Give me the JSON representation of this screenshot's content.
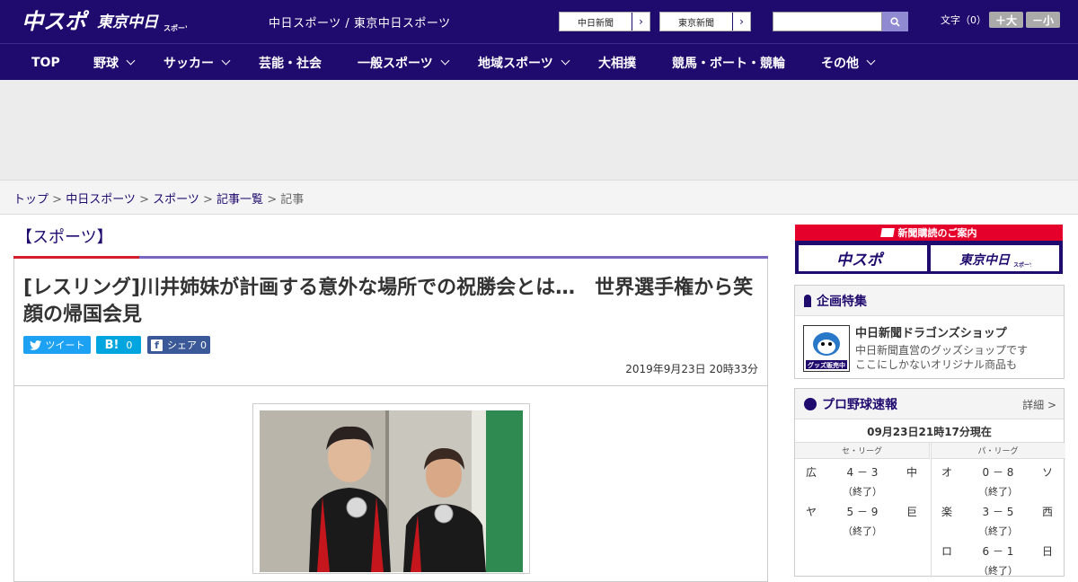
{
  "header": {
    "tagline": "中日スポーツ / 東京中日スポーツ",
    "ext_links": [
      {
        "label": "中日新聞"
      },
      {
        "label": "東京新聞"
      }
    ],
    "search_placeholder": "",
    "font_size_label": "文字（0）",
    "font_larger": "＋大",
    "font_smaller": "－小"
  },
  "nav": {
    "items": [
      {
        "label": "TOP",
        "has_dropdown": false
      },
      {
        "label": "野球",
        "has_dropdown": true
      },
      {
        "label": "サッカー",
        "has_dropdown": true
      },
      {
        "label": "芸能・社会",
        "has_dropdown": false
      },
      {
        "label": "一般スポーツ",
        "has_dropdown": true
      },
      {
        "label": "地域スポーツ",
        "has_dropdown": true
      },
      {
        "label": "大相撲",
        "has_dropdown": false
      },
      {
        "label": "競馬・ボート・競輪",
        "has_dropdown": false
      },
      {
        "label": "その他",
        "has_dropdown": true
      }
    ]
  },
  "breadcrumb": {
    "items": [
      "トップ",
      "中日スポーツ",
      "スポーツ",
      "記事一覧"
    ],
    "current": "記事"
  },
  "article": {
    "section": "【スポーツ】",
    "title": "[レスリング]川井姉妹が計画する意外な場所での祝勝会とは…　世界選手権から笑顔の帰国会見",
    "share": {
      "tweet_label": "ツイート",
      "hatena_count": "0",
      "facebook_label": "シェア",
      "facebook_count": "0"
    },
    "date": "2019年9月23日 20時33分"
  },
  "sidebar": {
    "subscribe": {
      "heading": "新聞購読のご案内"
    },
    "feature": {
      "heading": "企画特集",
      "title": "中日新聞ドラゴンズショップ",
      "desc_line1": "中日新聞直営のグッズショップです",
      "desc_line2": "ここにしかないオリジナル商品も"
    },
    "baseball": {
      "heading": "プロ野球速報",
      "detail": "詳細 >",
      "timestamp": "09月23日21時17分現在",
      "central_label": "セ・リーグ",
      "pacific_label": "パ・リーグ",
      "central_games": [
        {
          "team1": "広",
          "score": "4 － 3",
          "team2": "中",
          "status": "（終了）"
        },
        {
          "team1": "ヤ",
          "score": "5 － 9",
          "team2": "巨",
          "status": "（終了）"
        }
      ],
      "pacific_games": [
        {
          "team1": "オ",
          "score": "0 － 8",
          "team2": "ソ",
          "status": "（終了）"
        },
        {
          "team1": "楽",
          "score": "3 － 5",
          "team2": "西",
          "status": "（終了）"
        },
        {
          "team1": "ロ",
          "score": "6 － 1",
          "team2": "日",
          "status": "（終了）"
        }
      ]
    }
  },
  "colors": {
    "brand_navy": "#1f0a6e",
    "accent_red": "#d21e2b",
    "subscribe_red": "#e4002b"
  }
}
